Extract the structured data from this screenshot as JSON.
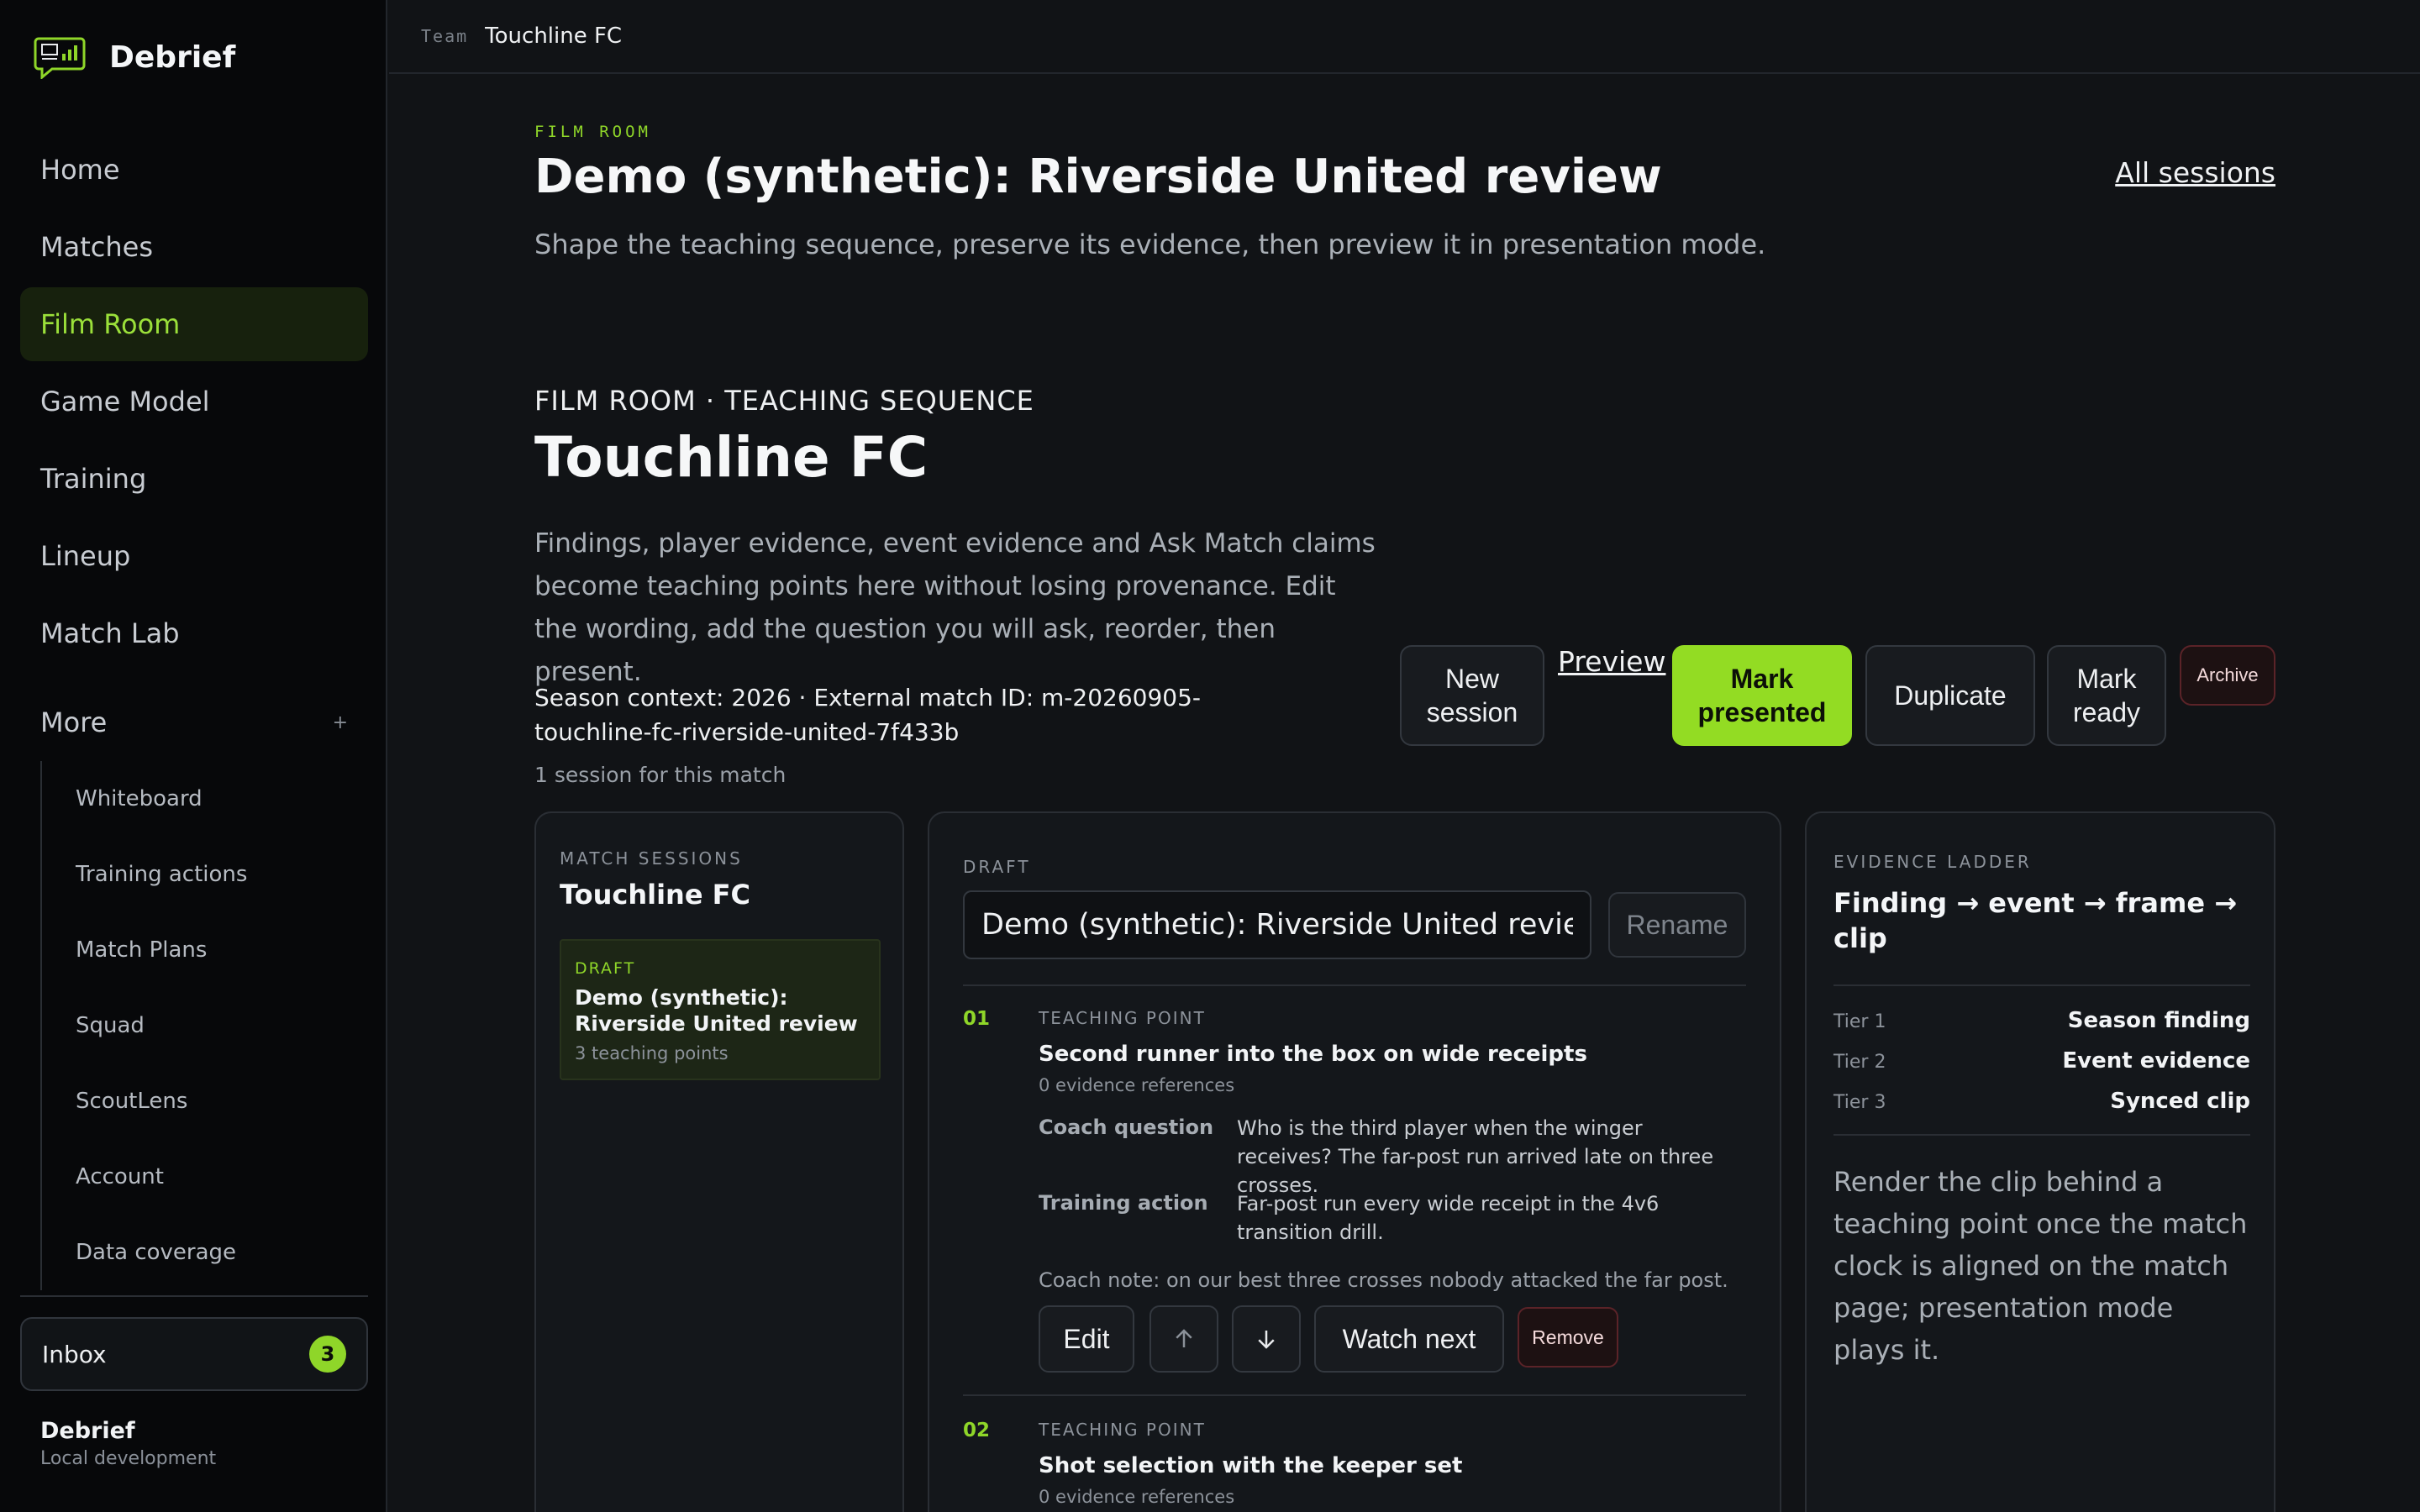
{
  "brand": {
    "name": "Debrief"
  },
  "nav": {
    "items": [
      {
        "label": "Home"
      },
      {
        "label": "Matches"
      },
      {
        "label": "Film Room"
      },
      {
        "label": "Game Model"
      },
      {
        "label": "Training"
      },
      {
        "label": "Lineup"
      },
      {
        "label": "Match Lab"
      }
    ],
    "more_label": "More",
    "more_icon": "+",
    "sub_items": [
      {
        "label": "Whiteboard"
      },
      {
        "label": "Training actions"
      },
      {
        "label": "Match Plans"
      },
      {
        "label": "Squad"
      },
      {
        "label": "ScoutLens"
      },
      {
        "label": "Account"
      },
      {
        "label": "Data coverage"
      }
    ]
  },
  "inbox": {
    "label": "Inbox",
    "count": "3"
  },
  "footer": {
    "name": "Debrief",
    "env": "Local development"
  },
  "topbar": {
    "team_label": "Team",
    "team_name": "Touchline FC"
  },
  "header": {
    "eyebrow": "FILM ROOM",
    "title": "Demo (synthetic): Riverside United review",
    "subtitle": "Shape the teaching sequence, preserve its evidence, then preview it in presentation mode.",
    "all_sessions": "All sessions"
  },
  "section": {
    "eyebrow": "FILM ROOM · TEACHING SEQUENCE",
    "title": "Touchline FC",
    "description": "Findings, player evidence, event evidence and Ask Match claims become teaching points here without losing provenance. Edit the wording, add the question you will ask, reorder, then present.",
    "season_context": "Season context: 2026 · External match ID: m-20260905-touchline-fc-riverside-united-7f433b",
    "session_count": "1 session for this match"
  },
  "actions": {
    "new_session": "New session",
    "preview": "Preview",
    "mark_presented": "Mark presented",
    "duplicate": "Duplicate",
    "mark_ready": "Mark ready",
    "archive": "Archive"
  },
  "sessions_panel": {
    "eyebrow": "MATCH SESSIONS",
    "title": "Touchline FC",
    "card": {
      "status": "DRAFT",
      "name": "Demo (synthetic): Riverside United review",
      "meta": "3 teaching points"
    }
  },
  "draft_panel": {
    "eyebrow": "DRAFT",
    "name_value": "Demo (synthetic): Riverside United review",
    "rename": "Rename",
    "points": [
      {
        "num": "01",
        "label": "TEACHING POINT",
        "title": "Second runner into the box on wide receipts",
        "refs": "0 evidence references",
        "coach_question_label": "Coach question",
        "coach_question": "Who is the third player when the winger receives? The far-post run arrived late on three crosses.",
        "training_action_label": "Training action",
        "training_action": "Far-post run every wide receipt in the 4v6 transition drill.",
        "note": "Coach note: on our best three crosses nobody attacked the far post.",
        "edit": "Edit",
        "watch_next": "Watch next",
        "remove": "Remove"
      },
      {
        "num": "02",
        "label": "TEACHING POINT",
        "title": "Shot selection with the keeper set",
        "refs": "0 evidence references"
      }
    ]
  },
  "evidence_panel": {
    "eyebrow": "EVIDENCE LADDER",
    "title": "Finding → event → frame → clip",
    "tiers": [
      {
        "label": "Tier 1",
        "value": "Season finding"
      },
      {
        "label": "Tier 2",
        "value": "Event evidence"
      },
      {
        "label": "Tier 3",
        "value": "Synced clip"
      }
    ],
    "note": "Render the clip behind a teaching point once the match clock is aligned on the match page; presentation mode plays it."
  },
  "colors": {
    "accent": "#93dc23",
    "background": "#111316",
    "sidebar": "#07080a",
    "danger": "#5b2328"
  }
}
